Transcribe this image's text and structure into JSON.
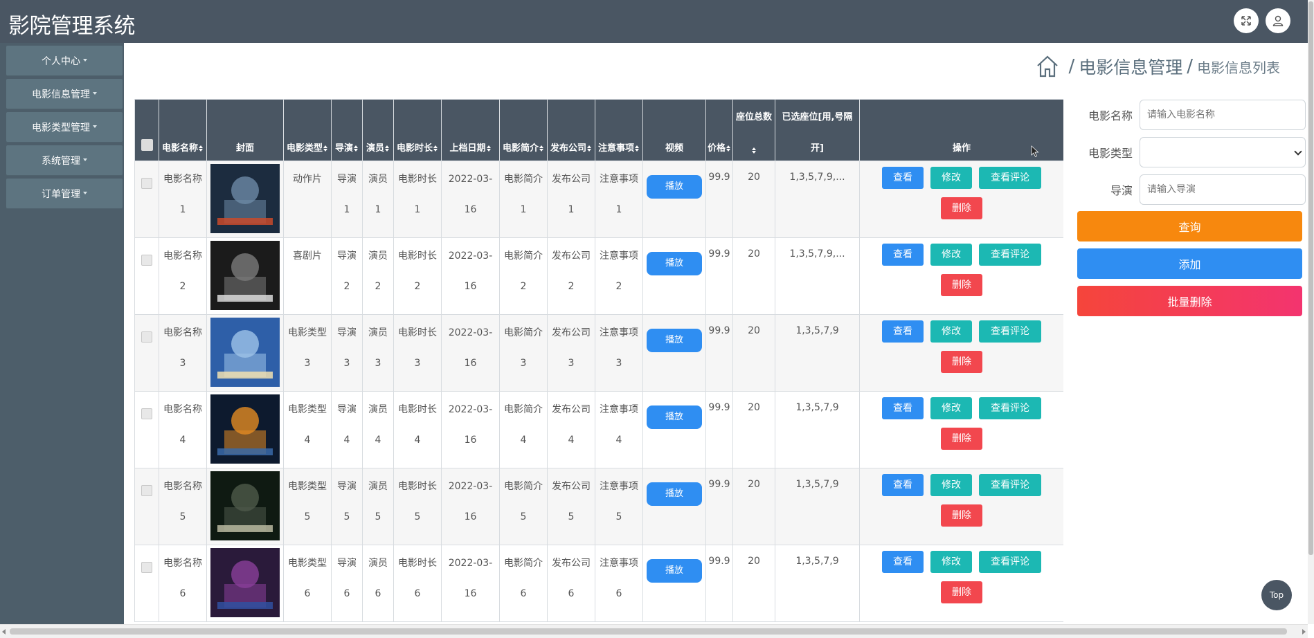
{
  "app": {
    "title": "影院管理系统"
  },
  "header": {
    "fullscreen_icon": "fullscreen-icon",
    "user_icon": "user-icon"
  },
  "sidebar": {
    "items": [
      {
        "label": "个人中心"
      },
      {
        "label": "电影信息管理"
      },
      {
        "label": "电影类型管理"
      },
      {
        "label": "系统管理"
      },
      {
        "label": "订单管理"
      }
    ]
  },
  "breadcrumb": {
    "sep": "/",
    "level1": "电影信息管理",
    "level2": "电影信息列表"
  },
  "table": {
    "headers": {
      "name": "电影名称",
      "cover": "封面",
      "type": "电影类型",
      "director": "导演",
      "actor": "演员",
      "duration": "电影时长",
      "date": "上档日期",
      "intro": "电影简介",
      "company": "发布公司",
      "notice": "注意事项",
      "video": "视频",
      "price": "价格",
      "seats_total": "座位总数",
      "seats_selected": "已选座位[用,号隔开]",
      "seats_selected_l1": "已选座位[用,号隔",
      "seats_selected_l2": "开]",
      "ops": "操作"
    },
    "play_label": "播放",
    "view_label": "查看",
    "edit_label": "修改",
    "comment_label": "查看评论",
    "delete_label": "删除",
    "rows": [
      {
        "name_a": "电影名称",
        "name_b": "1",
        "type_a": "动作片",
        "type_b": "",
        "director_a": "导演",
        "director_b": "1",
        "actor_a": "演员",
        "actor_b": "1",
        "duration_a": "电影时长",
        "duration_b": "1",
        "date_a": "2022-03-",
        "date_b": "16",
        "intro_a": "电影简介",
        "intro_b": "1",
        "company_a": "发布公司",
        "company_b": "1",
        "notice_a": "注意事项",
        "notice_b": "1",
        "price": "99.9",
        "seats_total": "20",
        "seats_selected": "1,3,5,7,9,..."
      },
      {
        "name_a": "电影名称",
        "name_b": "2",
        "type_a": "喜剧片",
        "type_b": "",
        "director_a": "导演",
        "director_b": "2",
        "actor_a": "演员",
        "actor_b": "2",
        "duration_a": "电影时长",
        "duration_b": "2",
        "date_a": "2022-03-",
        "date_b": "16",
        "intro_a": "电影简介",
        "intro_b": "2",
        "company_a": "发布公司",
        "company_b": "2",
        "notice_a": "注意事项",
        "notice_b": "2",
        "price": "99.9",
        "seats_total": "20",
        "seats_selected": "1,3,5,7,9,..."
      },
      {
        "name_a": "电影名称",
        "name_b": "3",
        "type_a": "电影类型",
        "type_b": "3",
        "director_a": "导演",
        "director_b": "3",
        "actor_a": "演员",
        "actor_b": "3",
        "duration_a": "电影时长",
        "duration_b": "3",
        "date_a": "2022-03-",
        "date_b": "16",
        "intro_a": "电影简介",
        "intro_b": "3",
        "company_a": "发布公司",
        "company_b": "3",
        "notice_a": "注意事项",
        "notice_b": "3",
        "price": "99.9",
        "seats_total": "20",
        "seats_selected": "1,3,5,7,9"
      },
      {
        "name_a": "电影名称",
        "name_b": "4",
        "type_a": "电影类型",
        "type_b": "4",
        "director_a": "导演",
        "director_b": "4",
        "actor_a": "演员",
        "actor_b": "4",
        "duration_a": "电影时长",
        "duration_b": "4",
        "date_a": "2022-03-",
        "date_b": "16",
        "intro_a": "电影简介",
        "intro_b": "4",
        "company_a": "发布公司",
        "company_b": "4",
        "notice_a": "注意事项",
        "notice_b": "4",
        "price": "99.9",
        "seats_total": "20",
        "seats_selected": "1,3,5,7,9"
      },
      {
        "name_a": "电影名称",
        "name_b": "5",
        "type_a": "电影类型",
        "type_b": "5",
        "director_a": "导演",
        "director_b": "5",
        "actor_a": "演员",
        "actor_b": "5",
        "duration_a": "电影时长",
        "duration_b": "5",
        "date_a": "2022-03-",
        "date_b": "16",
        "intro_a": "电影简介",
        "intro_b": "5",
        "company_a": "发布公司",
        "company_b": "5",
        "notice_a": "注意事项",
        "notice_b": "5",
        "price": "99.9",
        "seats_total": "20",
        "seats_selected": "1,3,5,7,9"
      },
      {
        "name_a": "电影名称",
        "name_b": "6",
        "type_a": "电影类型",
        "type_b": "6",
        "director_a": "导演",
        "director_b": "6",
        "actor_a": "演员",
        "actor_b": "6",
        "duration_a": "电影时长",
        "duration_b": "6",
        "date_a": "2022-03-",
        "date_b": "16",
        "intro_a": "电影简介",
        "intro_b": "6",
        "company_a": "发布公司",
        "company_b": "6",
        "notice_a": "注意事项",
        "notice_b": "6",
        "price": "99.9",
        "seats_total": "20",
        "seats_selected": "1,3,5,7,9"
      }
    ]
  },
  "search": {
    "name_label": "电影名称",
    "name_placeholder": "请输入电影名称",
    "type_label": "电影类型",
    "type_value": "",
    "director_label": "导演",
    "director_placeholder": "请输入导演",
    "query_label": "查询",
    "add_label": "添加",
    "batch_delete_label": "批量删除"
  },
  "top_button": {
    "label": "Top"
  },
  "colors": {
    "header_bg": "#4a5663",
    "sidebar_bg": "#4d5e6a",
    "menu_bg": "#5d7480",
    "primary": "#2f8ef2",
    "teal": "#1cb8b3",
    "danger": "#f2474e",
    "orange": "#f7880e"
  }
}
